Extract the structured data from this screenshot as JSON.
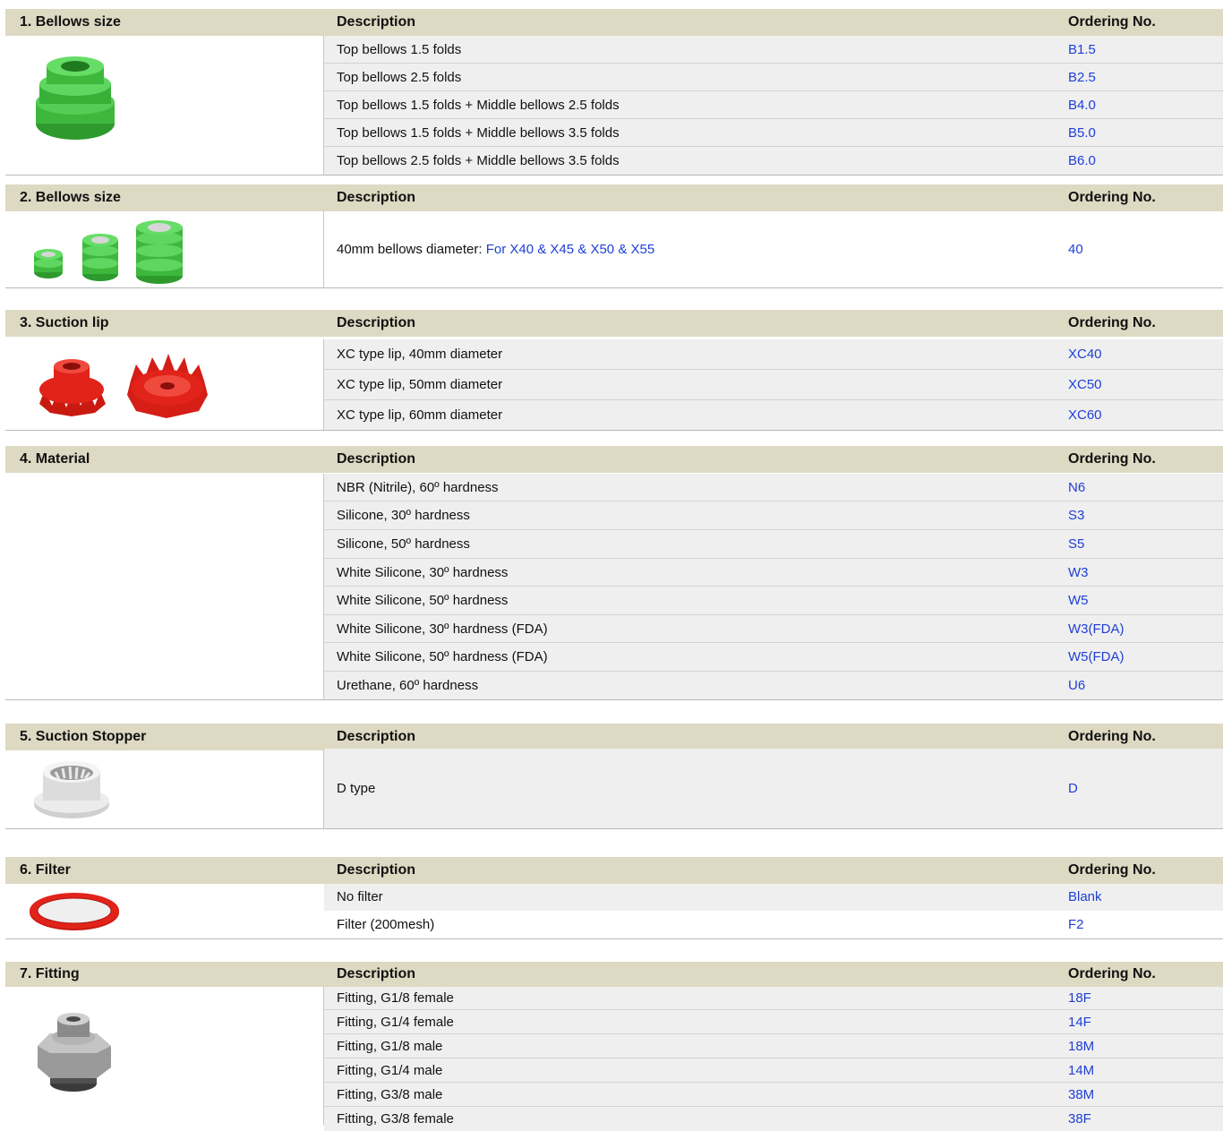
{
  "colors": {
    "header_bg": "#ddd9c3",
    "row_alt_bg": "#efefef",
    "order_link": "#1f3fd6",
    "bellows_green": "#3db83d",
    "lip_red": "#e2231a"
  },
  "sections": [
    {
      "title": "1. Bellows size",
      "desc_header": "Description",
      "order_header": "Ordering No.",
      "image": "green-bellows-icon",
      "rows": [
        {
          "desc": "Top bellows 1.5 folds",
          "code": "B1.5"
        },
        {
          "desc": "Top bellows 2.5 folds",
          "code": "B2.5"
        },
        {
          "desc": "Top bellows 1.5 folds + Middle bellows 2.5 folds",
          "code": "B4.0"
        },
        {
          "desc": "Top bellows 1.5 folds + Middle bellows 3.5 folds",
          "code": "B5.0"
        },
        {
          "desc": "Top bellows 2.5 folds + Middle bellows 3.5 folds",
          "code": "B6.0"
        }
      ]
    },
    {
      "title": "2. Bellows size",
      "desc_header": "Description",
      "order_header": "Ordering No.",
      "image": "green-bellows-set-icon",
      "rows": [
        {
          "desc": "40mm bellows diameter: ",
          "desc_link": "For X40 & X45 & X50 & X55",
          "code": "40"
        }
      ]
    },
    {
      "title": "3. Suction lip",
      "desc_header": "Description",
      "order_header": "Ordering No.",
      "image": "red-suction-lip-icon",
      "rows": [
        {
          "desc": "XC type lip, 40mm diameter",
          "code": "XC40"
        },
        {
          "desc": "XC type lip, 50mm diameter",
          "code": "XC50"
        },
        {
          "desc": "XC type lip, 60mm diameter",
          "code": "XC60"
        }
      ]
    },
    {
      "title": "4. Material",
      "desc_header": "Description",
      "order_header": "Ordering No.",
      "rows": [
        {
          "desc": "NBR (Nitrile), 60º hardness",
          "code": "N6"
        },
        {
          "desc": "Silicone, 30º hardness",
          "code": "S3"
        },
        {
          "desc": "Silicone, 50º hardness",
          "code": "S5"
        },
        {
          "desc": "White Silicone, 30º hardness",
          "code": "W3"
        },
        {
          "desc": "White Silicone, 50º hardness",
          "code": "W5"
        },
        {
          "desc": "White Silicone, 30º hardness (FDA)",
          "code": "W3(FDA)"
        },
        {
          "desc": "White Silicone, 50º hardness (FDA)",
          "code": "W5(FDA)"
        },
        {
          "desc": "Urethane, 60º hardness",
          "code": "U6"
        }
      ]
    },
    {
      "title": "5. Suction Stopper",
      "desc_header": "Description",
      "order_header": "Ordering No.",
      "image": "suction-stopper-icon",
      "rows": [
        {
          "desc": "D type",
          "code": "D"
        }
      ]
    },
    {
      "title": "6. Filter",
      "desc_header": "Description",
      "order_header": "Ordering No.",
      "image": "red-filter-ring-icon",
      "rows": [
        {
          "desc": "No filter",
          "code": "Blank"
        },
        {
          "desc": "Filter (200mesh)",
          "code": "F2"
        }
      ]
    },
    {
      "title": "7. Fitting",
      "desc_header": "Description",
      "order_header": "Ordering No.",
      "image": "metal-fitting-icon",
      "rows": [
        {
          "desc": "Fitting, G1/8 female",
          "code": "18F"
        },
        {
          "desc": "Fitting, G1/4 female",
          "code": "14F"
        },
        {
          "desc": "Fitting, G1/8 male",
          "code": "18M"
        },
        {
          "desc": "Fitting, G1/4 male",
          "code": "14M"
        },
        {
          "desc": "Fitting, G3/8 male",
          "code": "38M"
        },
        {
          "desc": "Fitting, G3/8 female",
          "code": "38F"
        }
      ]
    }
  ]
}
